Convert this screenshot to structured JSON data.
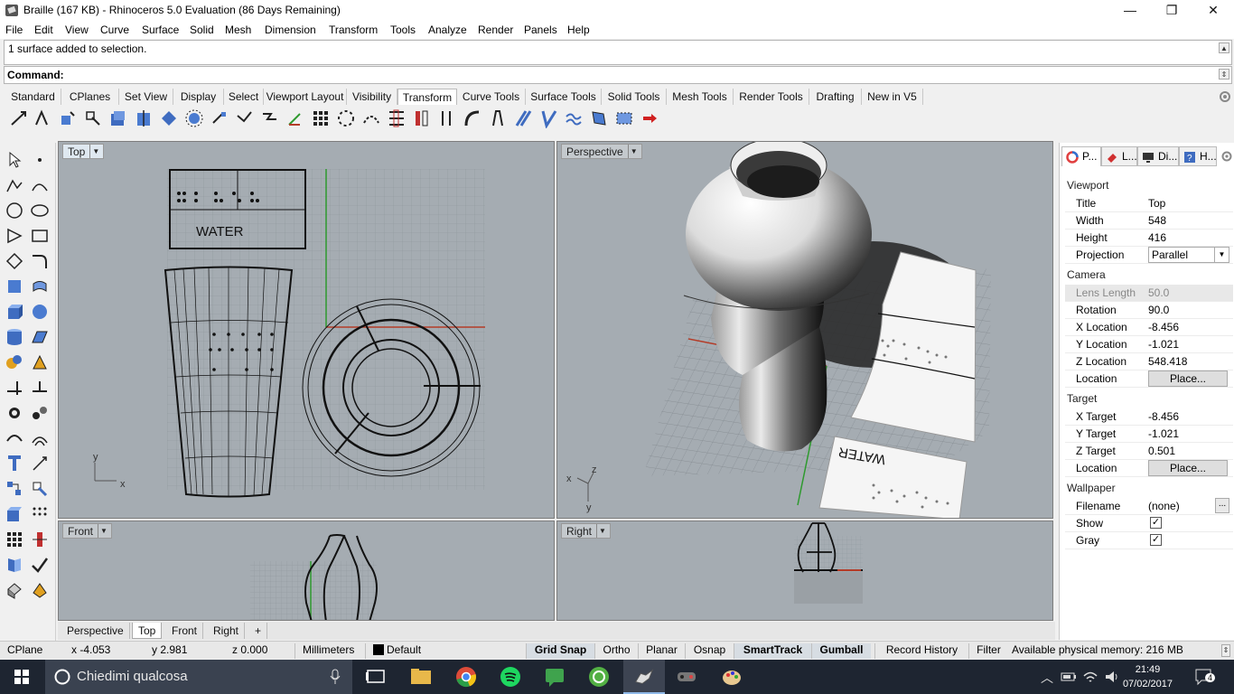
{
  "window": {
    "title": "Braille (167 KB) - Rhinoceros 5.0 Evaluation (86 Days Remaining)",
    "minimize": "—",
    "restore": "❐",
    "close": "✕"
  },
  "menu": [
    "File",
    "Edit",
    "View",
    "Curve",
    "Surface",
    "Solid",
    "Mesh",
    "Dimension",
    "Transform",
    "Tools",
    "Analyze",
    "Render",
    "Panels",
    "Help"
  ],
  "command": {
    "history": "1 surface added to selection.",
    "prompt": "Command:"
  },
  "toolbar_tabs": [
    "Standard",
    "CPlanes",
    "Set View",
    "Display",
    "Select",
    "Viewport Layout",
    "Visibility",
    "Transform",
    "Curve Tools",
    "Surface Tools",
    "Solid Tools",
    "Mesh Tools",
    "Render Tools",
    "Drafting",
    "New in V5"
  ],
  "active_tab": "Transform",
  "viewports": {
    "top": "Top",
    "perspective": "Perspective",
    "front": "Front",
    "right": "Right",
    "water_label": "WATER",
    "axis_x": "x",
    "axis_y": "y",
    "axis_z": "z"
  },
  "viewport_tabs": [
    "Perspective",
    "Top",
    "Front",
    "Right"
  ],
  "viewport_tabs_add": "+",
  "status": {
    "cplane": "CPlane",
    "x": "x -4.053",
    "y": "y 2.981",
    "z": "z 0.000",
    "units": "Millimeters",
    "layer": "Default",
    "grid_snap": "Grid Snap",
    "ortho": "Ortho",
    "planar": "Planar",
    "osnap": "Osnap",
    "smarttrack": "SmartTrack",
    "gumball": "Gumball",
    "record_history": "Record History",
    "filter": "Filter",
    "memory": "Available physical memory: 216 MB"
  },
  "panel": {
    "tabs": [
      "P...",
      "L...",
      "Di...",
      "H..."
    ],
    "sections": {
      "viewport": "Viewport",
      "camera": "Camera",
      "target": "Target",
      "wallpaper": "Wallpaper"
    },
    "viewport_rows": [
      {
        "k": "Title",
        "v": "Top"
      },
      {
        "k": "Width",
        "v": "548"
      },
      {
        "k": "Height",
        "v": "416"
      }
    ],
    "projection": {
      "k": "Projection",
      "v": "Parallel"
    },
    "camera_rows": [
      {
        "k": "Lens Length",
        "v": "50.0"
      },
      {
        "k": "Rotation",
        "v": "90.0"
      },
      {
        "k": "X Location",
        "v": "-8.456"
      },
      {
        "k": "Y Location",
        "v": "-1.021"
      },
      {
        "k": "Z Location",
        "v": "548.418"
      }
    ],
    "camera_location": {
      "k": "Location",
      "btn": "Place..."
    },
    "target_rows": [
      {
        "k": "X Target",
        "v": "-8.456"
      },
      {
        "k": "Y Target",
        "v": "-1.021"
      },
      {
        "k": "Z Target",
        "v": "0.501"
      }
    ],
    "target_location": {
      "k": "Location",
      "btn": "Place..."
    },
    "filename": {
      "k": "Filename",
      "v": "(none)",
      "btn": "..."
    },
    "show": {
      "k": "Show",
      "checked": true
    },
    "gray": {
      "k": "Gray",
      "checked": true
    }
  },
  "taskbar": {
    "search": "Chiedimi qualcosa",
    "time": "21:49",
    "date": "07/02/2017",
    "notifications": "4"
  },
  "colors": {
    "viewport_bg": "#a5acb2",
    "grid_line": "#8e959b",
    "x_axis": "#b43c28",
    "y_axis": "#2e9a2e",
    "taskbar": "#1e2531"
  }
}
